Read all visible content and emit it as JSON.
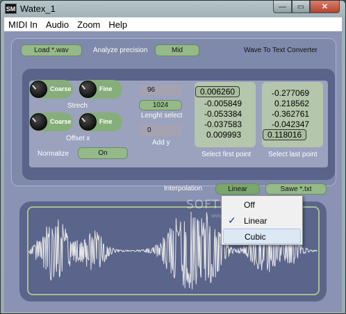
{
  "window": {
    "title": "Watex_1",
    "icon_text": "SM"
  },
  "titlebar_buttons": {
    "minimize": "—",
    "maximize": "▭",
    "close": "✕"
  },
  "menu": [
    "MIDI In",
    "Audio",
    "Zoom",
    "Help"
  ],
  "top": {
    "load_button": "Load   *.wav",
    "analyze_label": "Analyze precision",
    "precision_value": "Mid",
    "app_caption": "Wave To Text Converter"
  },
  "knobs": {
    "coarse": "Coarse",
    "fine": "Fine",
    "strech_label": "Strech",
    "offset_label": "Offset x"
  },
  "fields": {
    "top_value": "96",
    "length_value": "1024",
    "length_label": "Lenght select",
    "add_y_value": "0",
    "add_y_label": "Add y"
  },
  "first_points": {
    "values": [
      "0.006260",
      "-0.005849",
      "-0.053384",
      "-0.037583",
      "0.009993"
    ],
    "label": "Select first point"
  },
  "last_points": {
    "values": [
      "-0.277069",
      "0.218562",
      "-0.362761",
      "-0.042347",
      "0.118016"
    ],
    "label": "Select last point"
  },
  "normalize": {
    "label": "Normalize",
    "value": "On"
  },
  "interpolation": {
    "label": "Interpolation",
    "value": "Linear",
    "save_button": "Sawe    *.txt",
    "options": [
      "Off",
      "Linear",
      "Cubic"
    ],
    "checked": "Linear",
    "highlighted": "Cubic"
  },
  "watermark": {
    "text": "SOFTPEDIA",
    "sub": "www.softpedia.com"
  },
  "colors": {
    "panel": "#8a93b4",
    "inner": "#5a6389",
    "green_button": "#95b988",
    "wave": "#e6e6e6"
  }
}
